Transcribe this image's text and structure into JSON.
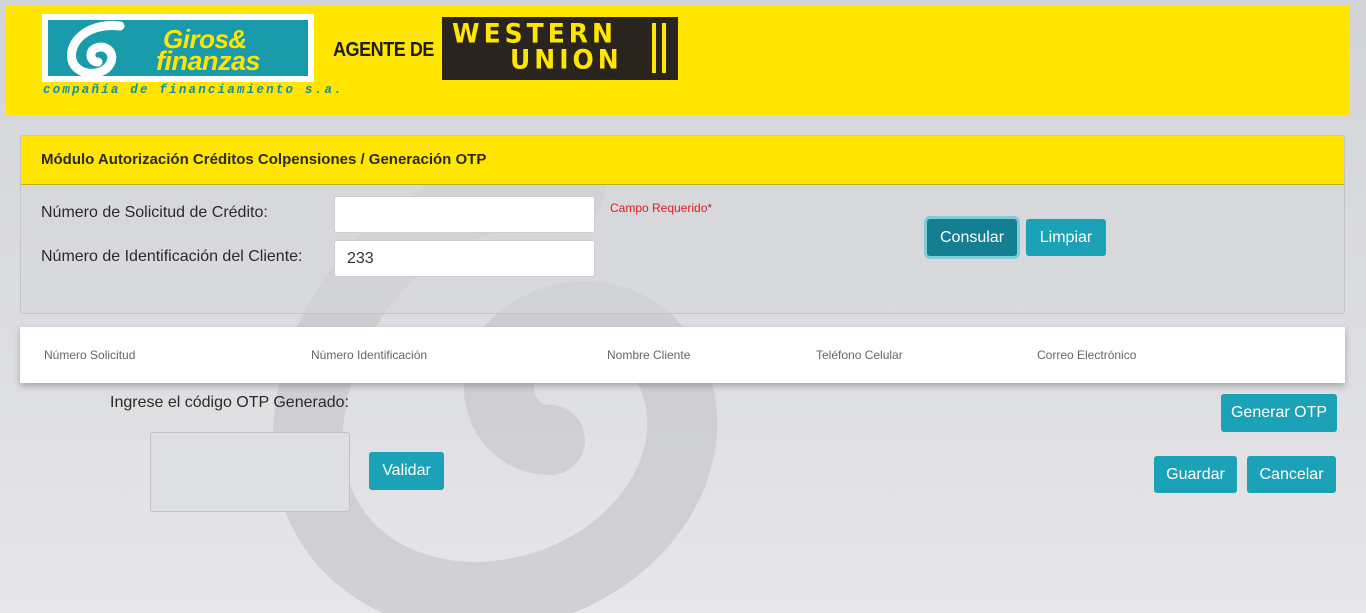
{
  "header": {
    "brand_line1": "Giros&",
    "brand_line2": "finanzas",
    "tagline": "compañía de financiamiento s.a.",
    "agent_text": "AGENTE DE",
    "partner_line1": "WESTERN",
    "partner_line2": "UNION",
    "colors": {
      "brand_yellow": "#ffe500",
      "brand_teal": "#1a9bab"
    }
  },
  "panel": {
    "title": "Módulo Autorización Créditos Colpensiones / Generación OTP",
    "fields": {
      "solicitud_label": "Número de Solicitud de Crédito:",
      "solicitud_value": "",
      "identificacion_label": "Número de Identificación del Cliente:",
      "identificacion_value": "233"
    },
    "required_message": "Campo Requerido*",
    "buttons": {
      "consultar": "Consular",
      "limpiar": "Limpiar"
    }
  },
  "results_table": {
    "columns": [
      "Número Solicitud",
      "Número Identificación",
      "Nombre Cliente",
      "Teléfono Celular",
      "Correo Electrónico"
    ]
  },
  "otp": {
    "label": "Ingrese el código OTP Generado:",
    "value": "",
    "buttons": {
      "validar": "Validar",
      "generar": "Generar OTP",
      "guardar": "Guardar",
      "cancelar": "Cancelar"
    }
  },
  "colors": {
    "button": "#1ba2b7",
    "button_active": "#147f91",
    "error": "#e01b1b"
  }
}
